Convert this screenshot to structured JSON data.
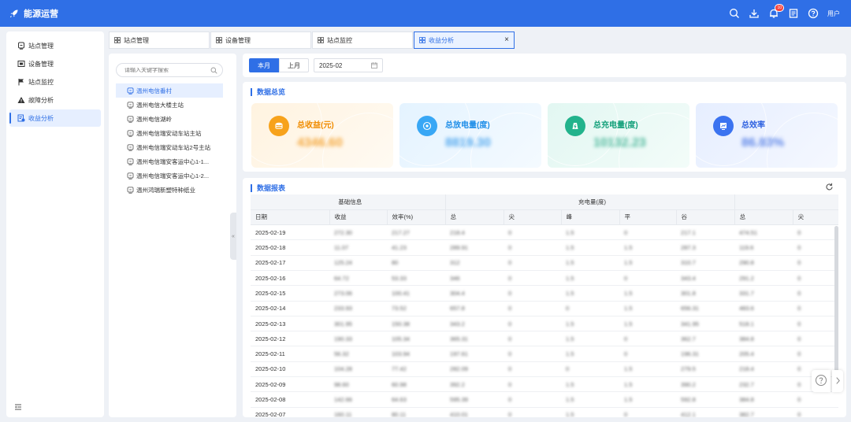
{
  "app": {
    "title": "能源运营"
  },
  "header": {
    "notification_count": "10",
    "user_name": "用户",
    "icons": [
      "search-icon",
      "download-icon",
      "bell-icon",
      "document-icon",
      "help-icon"
    ]
  },
  "menu": {
    "items": [
      {
        "label": "站点管理",
        "icon": "station-icon"
      },
      {
        "label": "设备管理",
        "icon": "device-icon"
      },
      {
        "label": "站点监控",
        "icon": "flag-icon"
      },
      {
        "label": "故障分析",
        "icon": "warning-icon"
      },
      {
        "label": "收益分析",
        "icon": "revenue-icon",
        "active": true
      }
    ]
  },
  "tabs": [
    {
      "label": "站点管理"
    },
    {
      "label": "设备管理"
    },
    {
      "label": "站点监控"
    },
    {
      "label": "收益分析",
      "active": true
    }
  ],
  "search": {
    "placeholder": "请输入关键字搜索"
  },
  "stations": [
    {
      "label": "温州电信番村",
      "active": true
    },
    {
      "label": "温州电信大楼主站"
    },
    {
      "label": "温州电信湖岭"
    },
    {
      "label": "温州电信瑞安动车站主站"
    },
    {
      "label": "温州电信瑞安动车站2号主站"
    },
    {
      "label": "温州电信瑞安客运中心1-1..."
    },
    {
      "label": "温州电信瑞安客运中心1-2..."
    },
    {
      "label": "温州鸿瑞新塑特种纸业"
    }
  ],
  "toolbar": {
    "this_month": "本月",
    "last_month": "上月",
    "month_value": "2025-02"
  },
  "overview": {
    "title": "数据总览",
    "cards": [
      {
        "label": "总收益(元)",
        "value": "4346.60",
        "icon": "coin-icon"
      },
      {
        "label": "总放电量(度)",
        "value": "8819.30",
        "icon": "discharge-icon"
      },
      {
        "label": "总充电量(度)",
        "value": "10132.23",
        "icon": "charge-icon"
      },
      {
        "label": "总效率",
        "value": "86.83%",
        "icon": "efficiency-icon"
      }
    ]
  },
  "report": {
    "title": "数据报表",
    "group_headers": [
      "基础信息",
      "充电量(度)",
      ""
    ],
    "columns": [
      "日期",
      "收益",
      "效率(%)",
      "总",
      "尖",
      "峰",
      "平",
      "谷",
      "总",
      "尖"
    ],
    "rows": [
      [
        "2025-02-19",
        "272.30",
        "217.27",
        "218.4",
        "0",
        "1.5",
        "0",
        "217.1",
        "474.51",
        "0"
      ],
      [
        "2025-02-18",
        "11.07",
        "41.23",
        "289.91",
        "0",
        "1.5",
        "1.5",
        "287.3",
        "119.6",
        "0"
      ],
      [
        "2025-02-17",
        "125.24",
        "80",
        "312",
        "0",
        "1.5",
        "1.5",
        "310.7",
        "290.8",
        "0"
      ],
      [
        "2025-02-16",
        "64.72",
        "53.33",
        "346",
        "0",
        "1.5",
        "0",
        "343.4",
        "291.2",
        "0"
      ],
      [
        "2025-02-15",
        "273.06",
        "100.41",
        "304.4",
        "0",
        "1.5",
        "1.5",
        "301.8",
        "331.7",
        "0"
      ],
      [
        "2025-02-14",
        "233.93",
        "73.52",
        "657.8",
        "0",
        "0",
        "1.5",
        "656.31",
        "483.6",
        "0"
      ],
      [
        "2025-02-13",
        "301.95",
        "150.38",
        "343.2",
        "0",
        "1.5",
        "1.5",
        "341.95",
        "518.1",
        "0"
      ],
      [
        "2025-02-12",
        "190.33",
        "105.34",
        "365.31",
        "0",
        "1.5",
        "0",
        "362.7",
        "384.8",
        "0"
      ],
      [
        "2025-02-11",
        "56.32",
        "103.94",
        "197.61",
        "0",
        "1.5",
        "0",
        "196.31",
        "205.4",
        "0"
      ],
      [
        "2025-02-10",
        "104.28",
        "77.42",
        "282.09",
        "0",
        "0",
        "1.5",
        "279.5",
        "218.4",
        "0"
      ],
      [
        "2025-02-09",
        "98.60",
        "60.98",
        "392.2",
        "0",
        "1.5",
        "1.5",
        "390.2",
        "232.7",
        "0"
      ],
      [
        "2025-02-08",
        "142.66",
        "64.63",
        "595.39",
        "0",
        "1.5",
        "1.5",
        "592.8",
        "384.8",
        "0"
      ],
      [
        "2025-02-07",
        "160.11",
        "80.11",
        "410.01",
        "0",
        "1.5",
        "0",
        "412.1",
        "382.7",
        "0"
      ]
    ]
  },
  "colors": {
    "primary": "#2f6fe6",
    "orange": "#f7a21b",
    "sky": "#38a7f5",
    "teal": "#22b38c",
    "blue": "#3b73f0"
  }
}
